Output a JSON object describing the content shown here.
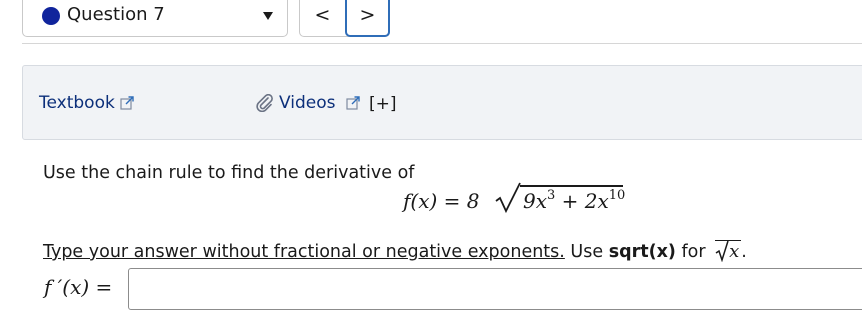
{
  "nav": {
    "question_label": "Question 7",
    "prev_symbol": "<",
    "next_symbol": ">",
    "accent_color": "#10249c",
    "focus_color": "#2f6db8"
  },
  "resources": {
    "textbook_label": "Textbook",
    "videos_label": "Videos",
    "expand_label": "[+]",
    "icons": [
      "external-link-icon",
      "paperclip-icon"
    ]
  },
  "question": {
    "prompt": "Use the chain rule to find the derivative of",
    "formula": {
      "lhs": "f(x) = 8",
      "radicand_parts": [
        "9x",
        "3",
        " + 2x",
        "10"
      ]
    },
    "instruction_link": "Type your answer without fractional or negative exponents.",
    "instruction_use": " Use ",
    "instruction_code": "sqrt(x)",
    "instruction_for": " for ",
    "instruction_var": "x",
    "instruction_end": ".",
    "answer_label": "f ′(x) =",
    "answer_value": ""
  }
}
